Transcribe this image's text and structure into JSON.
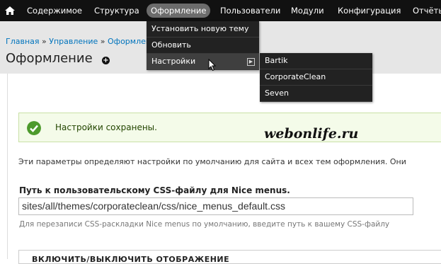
{
  "toolbar": {
    "home_icon": "home-icon",
    "items": [
      {
        "label": "Содержимое"
      },
      {
        "label": "Структура"
      },
      {
        "label": "Оформление"
      },
      {
        "label": "Пользователи"
      },
      {
        "label": "Модули"
      },
      {
        "label": "Конфигурация"
      },
      {
        "label": "Отчёты"
      }
    ]
  },
  "dropdown": {
    "items": [
      {
        "label": "Установить новую тему"
      },
      {
        "label": "Обновить"
      },
      {
        "label": "Настройки"
      }
    ],
    "submenu": [
      {
        "label": "Bartik"
      },
      {
        "label": "CorporateClean"
      },
      {
        "label": "Seven"
      }
    ]
  },
  "breadcrumb": {
    "home": "Главная",
    "sep": "»",
    "admin": "Управление",
    "current": "Оформление"
  },
  "page": {
    "title": "Оформление"
  },
  "message": {
    "text": "Настройки сохранены.",
    "status_color": "#4d9a2c"
  },
  "watermark": "webonlife.ru",
  "form": {
    "description": "Эти параметры определяют настройки по умолчанию для сайта и всех тем оформления. Они",
    "css_label": "Путь к пользовательскому CSS-файлу для Nice menus.",
    "css_value": "sites/all/themes/corporateclean/css/nice_menus_default.css",
    "css_help": "Для перезаписи CSS-раскладки Nice menus по умолчанию, введите путь к вашему CSS-файлу",
    "fieldset_legend": "ВКЛЮЧИТЬ/ВЫКЛЮЧИТЬ ОТОБРАЖЕНИЕ"
  },
  "colors": {
    "toolbar_bg": "#111111",
    "active_menu_bg": "#6c6c6c",
    "link": "#0074bd",
    "message_bg": "#f4fbe9"
  }
}
